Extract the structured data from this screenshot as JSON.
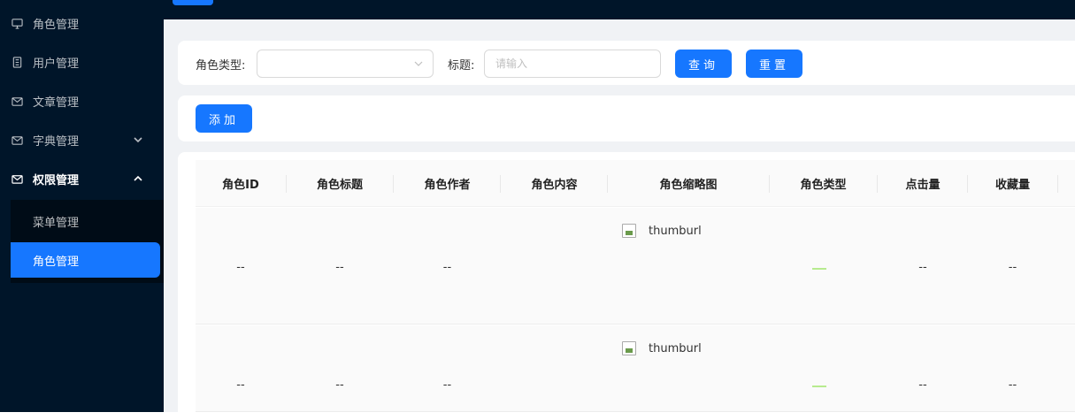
{
  "sidebar": {
    "items": [
      {
        "label": "角色管理",
        "icon": "monitor-icon"
      },
      {
        "label": "用户管理",
        "icon": "book-icon"
      },
      {
        "label": "文章管理",
        "icon": "mail-icon"
      },
      {
        "label": "字典管理",
        "icon": "mail-icon"
      },
      {
        "label": "权限管理",
        "icon": "mail-icon"
      }
    ],
    "submenu": [
      {
        "label": "菜单管理"
      },
      {
        "label": "角色管理"
      }
    ]
  },
  "search": {
    "role_type_label": "角色类型:",
    "title_label": "标题:",
    "title_placeholder": "请输入",
    "query_button": "查询",
    "reset_button": "重置"
  },
  "actions": {
    "add_button": "添加"
  },
  "table": {
    "columns": [
      "角色ID",
      "角色标题",
      "角色作者",
      "角色内容",
      "角色缩略图",
      "角色类型",
      "点击量",
      "收藏量"
    ],
    "rows": [
      {
        "id": "--",
        "title": "--",
        "author": "--",
        "content": "",
        "thumb": "thumburl",
        "type": "",
        "clicks": "--",
        "favorites": "--"
      },
      {
        "id": "--",
        "title": "--",
        "author": "--",
        "content": "",
        "thumb": "thumburl",
        "type": "",
        "clicks": "--",
        "favorites": "--"
      }
    ]
  },
  "colors": {
    "sidebar_bg": "#001529",
    "accent": "#1677ff",
    "tag_green": "#b7eb8f"
  }
}
